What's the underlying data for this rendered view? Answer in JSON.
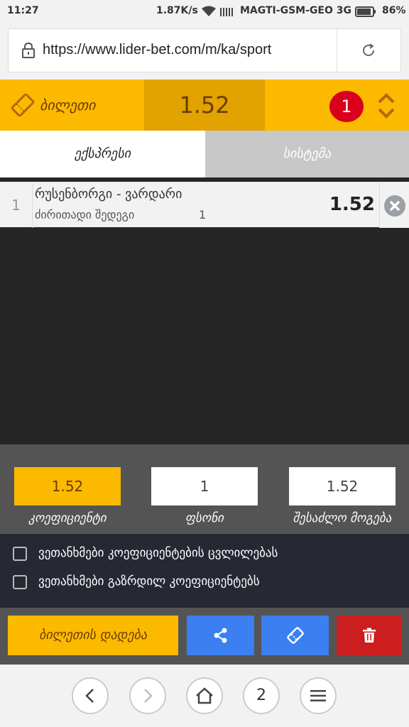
{
  "status_bar": {
    "time": "11:27",
    "speed": "1.87K/s",
    "carrier": "MAGTI-GSM-GEO 3G",
    "battery": "86%"
  },
  "browser": {
    "url": "https://www.lider-bet.com/m/ka/sport"
  },
  "ticket": {
    "title": "ბილეთი",
    "odds": "1.52",
    "count": "1"
  },
  "tabs": {
    "express": "ექსპრესი",
    "system": "სისტემა"
  },
  "bet": {
    "index": "1",
    "match": "რუსენბორგი - ვარდარი",
    "market": "ძირითადი შედეგი",
    "pick": "1",
    "odds": "1.52"
  },
  "summary": {
    "coefficient_value": "1.52",
    "stake_value": "1",
    "possible_win_value": "1.52",
    "coefficient_label": "კოეფიციენტი",
    "stake_label": "ფსონი",
    "possible_win_label": "შესაძლო მოგება"
  },
  "options": {
    "accept_odds_change": "ვეთანხმები კოეფიციენტების ცვლილებას",
    "accept_boosted_odds": "ვეთანხმები გაზრდილ კოეფიციენტებს"
  },
  "actions": {
    "place_bet": "ბილეთის დადება"
  },
  "bottom_nav": {
    "tab_count": "2"
  },
  "colors": {
    "brand_yellow": "#fbb900",
    "brand_dark_yellow": "#e2a200",
    "badge_red": "#d9001b",
    "action_blue": "#3b7ff0",
    "delete_red": "#cc1e1e"
  }
}
